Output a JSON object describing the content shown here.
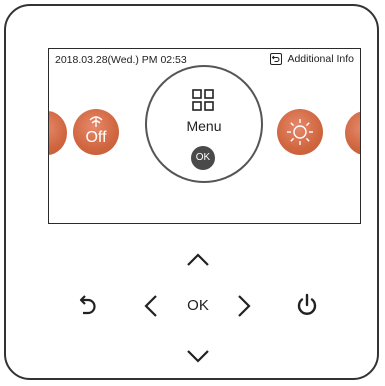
{
  "status_bar": {
    "datetime": "2018.03.28(Wed.) PM 02:53",
    "additional_info": "Additional Info"
  },
  "carousel": {
    "off_label": "Off",
    "menu_label": "Menu",
    "menu_ok": "OK"
  },
  "keypad": {
    "ok_label": "OK"
  },
  "colors": {
    "accent": "#d0663f",
    "ok_chip": "#4a4a4a",
    "frame": "#333333"
  },
  "icons": {
    "off_mode": "fan-mode-icon",
    "menu": "grid-icon",
    "sun": "sun-icon",
    "back": "back-icon",
    "power": "power-icon"
  }
}
